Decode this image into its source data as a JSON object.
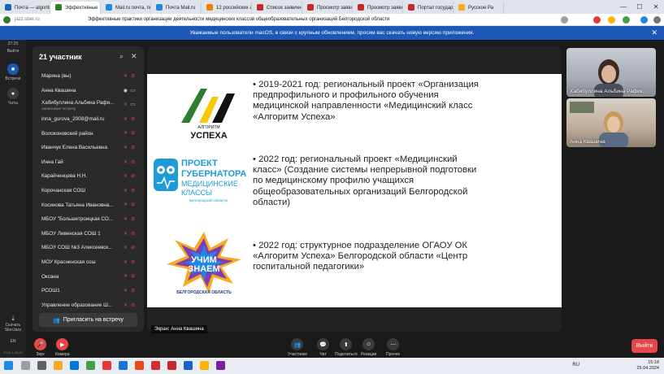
{
  "browser": {
    "tabs": [
      {
        "label": "Почта — algoritm",
        "color": "#1565c0"
      },
      {
        "label": "Эффективные",
        "color": "#2e7d32",
        "active": true
      },
      {
        "label": "Mail.ru почта, пои",
        "color": "#1e88e5"
      },
      {
        "label": "Почта Mail.ru",
        "color": "#1e88e5"
      },
      {
        "label": "12 российских ак",
        "color": "#f57c00"
      },
      {
        "label": "Список заявлений",
        "color": "#c62828"
      },
      {
        "label": "Просмотр заявлен",
        "color": "#c62828"
      },
      {
        "label": "Просмотр заявле",
        "color": "#c62828"
      },
      {
        "label": "Портал государст",
        "color": "#c62828"
      },
      {
        "label": "Русское Ра",
        "color": "#f9a825"
      }
    ],
    "url": "jazz.sber.ru",
    "page_title": "Эффективные практики организации деятельности медицинских классов общеобразовательных организаций Белгородской области"
  },
  "banner": {
    "text": "Уважаемые пользователи macOS, в связи с крупным обновлением, просим вас скачать новую версию приложения.",
    "close": "✕"
  },
  "rail": {
    "time": "27:25",
    "exit": "Выйти",
    "meetings": "Встречи",
    "chats": "Чаты",
    "download": "Скачать SberJazz",
    "lang": "EN",
    "version": "2024.1.40.20"
  },
  "participants": {
    "title": "21 участник",
    "invite_label": "Пригласить на встречу",
    "list": [
      {
        "name": "Марина (вы)",
        "mic": "off",
        "cam": "off"
      },
      {
        "name": "Анна Квашина",
        "mic": "on",
        "cam": "on"
      },
      {
        "name": "Хабибуллина Альбина Рафи...",
        "sub": "Записывает встречу",
        "mic": "off",
        "cam": "on"
      },
      {
        "name": "inna_gurova_2008@mail.ru",
        "mic": "off",
        "cam": "off"
      },
      {
        "name": "Волоконовский район",
        "mic": "off",
        "cam": "off"
      },
      {
        "name": "Иванчук Елена Васильевна",
        "mic": "off",
        "cam": "off"
      },
      {
        "name": "Инна Гай",
        "mic": "off",
        "cam": "off"
      },
      {
        "name": "Карайченцева Н.Н.",
        "mic": "off",
        "cam": "off"
      },
      {
        "name": "Корочанская СОШ",
        "mic": "off",
        "cam": "off"
      },
      {
        "name": "Косинова Татьяна Ивановна...",
        "mic": "off",
        "cam": "off"
      },
      {
        "name": "МБОУ \"Большетроицкая СО...",
        "mic": "off",
        "cam": "off"
      },
      {
        "name": "МБОУ Ливенская СОШ 1",
        "mic": "off",
        "cam": "off"
      },
      {
        "name": "МБОУ СОШ №3 Алексеевск...",
        "mic": "off",
        "cam": "off"
      },
      {
        "name": "МОУ Красненская сош",
        "mic": "off",
        "cam": "off"
      },
      {
        "name": "Оксана",
        "mic": "off",
        "cam": "off"
      },
      {
        "name": "РСОШ1",
        "mic": "off",
        "cam": "off"
      },
      {
        "name": "Управление образование Ш...",
        "mic": "off",
        "cam": "off"
      }
    ]
  },
  "slide": {
    "logo1": {
      "top": "АЛГОРИТМ",
      "bottom": "УСПЕХА"
    },
    "logo2": {
      "line1": "ПРОЕКТ",
      "line2": "ГУБЕРНАТОРА",
      "line3": "МЕДИЦИНСКИЕ",
      "line4": "КЛАССЫ",
      "line5": "Белгородской области"
    },
    "logo3": {
      "line1": "УЧИМ",
      "line2": "ЗНАЕМ",
      "caption": "БЕЛГОРОДСКАЯ ОБЛАСТЬ"
    },
    "bullets": [
      [
        "• 2019-2021 год: региональный проект «Организация",
        "предпрофильного и профильного обучения",
        "медицинской направленности «Медицинский класс",
        "«Алгоритм Успеха»"
      ],
      [
        "• 2022 год: региональный проект «Медицинский",
        "класс» (Создание системы непрерывной подготовки",
        "по медицинскому профилю учащихся",
        "общеобразовательных организаций Белгородской",
        "области)"
      ],
      [
        "• 2022 год: структурное подразделение ОГАОУ ОК",
        "«Алгоритм Успеха» Белгородской области «Центр",
        "госпитальной педагогики»"
      ]
    ]
  },
  "screen_label": "Экран: Анна Квашина",
  "videos": [
    {
      "name": "Хабибуллина Альбина Рафик..."
    },
    {
      "name": "Анна Квашина"
    }
  ],
  "controls": {
    "mic": "Звук",
    "cam": "Камера",
    "participants": "Участники",
    "chat": "Чат",
    "share": "Поделиться",
    "reactions": "Реакции",
    "more": "Прочее",
    "leave": "Выйти"
  },
  "taskbar": {
    "lang": "RU",
    "time": "15:18",
    "date": "25.04.2024"
  }
}
